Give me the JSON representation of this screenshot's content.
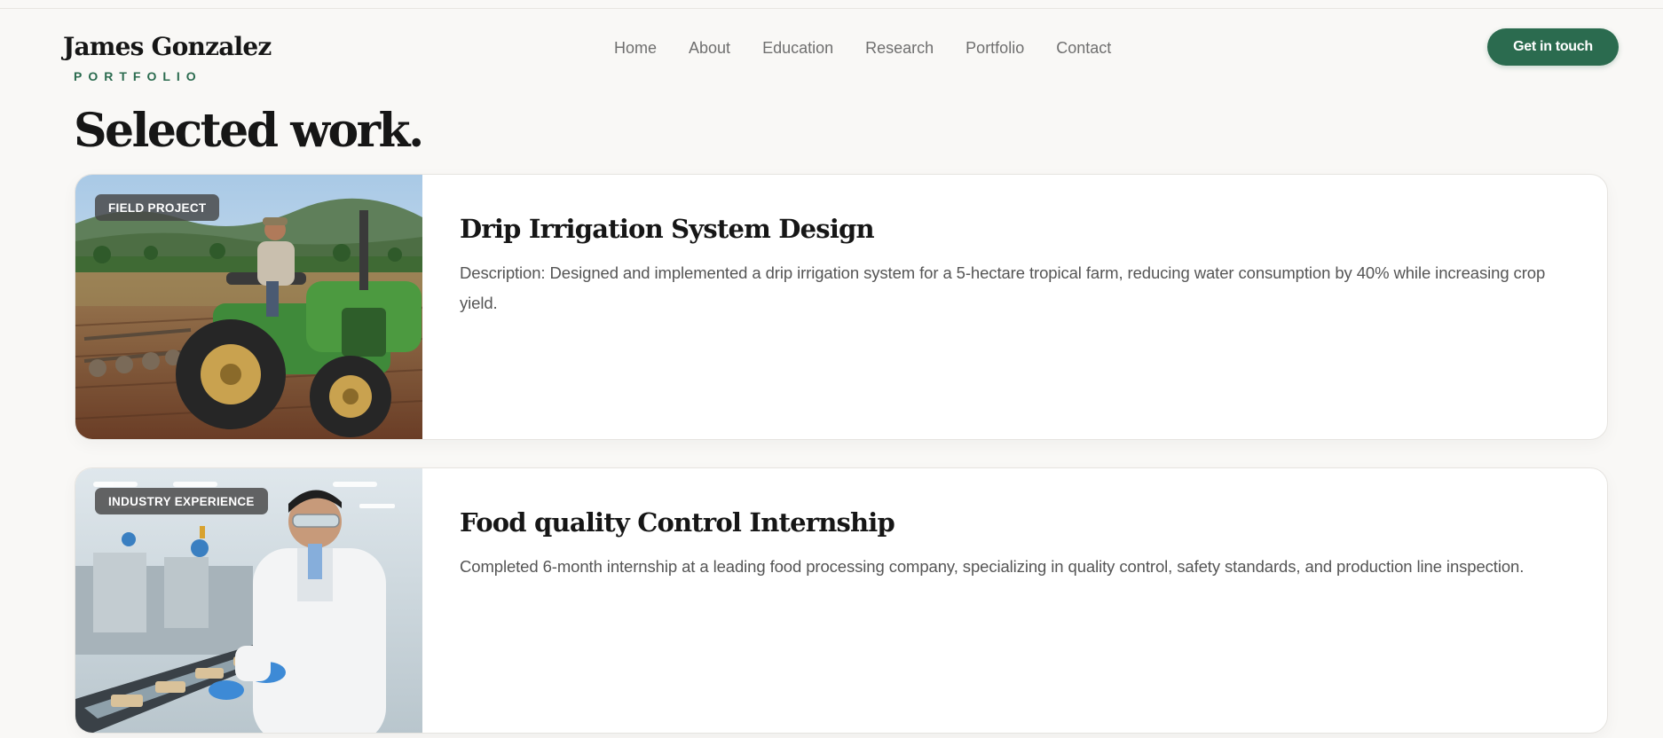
{
  "header": {
    "brand_name": "James Gonzalez",
    "brand_sub": "PORTFOLIO",
    "nav": [
      "Home",
      "About",
      "Education",
      "Research",
      "Portfolio",
      "Contact"
    ],
    "cta_label": "Get in touch"
  },
  "section": {
    "title": "Selected work."
  },
  "cards": [
    {
      "badge": "FIELD PROJECT",
      "title": "Drip Irrigation System Design",
      "description": "Description: Designed and implemented a drip irrigation system for a 5-hectare tropical farm, reducing water consumption by 40% while increasing crop yield."
    },
    {
      "badge": "INDUSTRY EXPERIENCE",
      "title": "Food quality Control Internship",
      "description": "Completed 6-month internship at a leading food processing company, specializing in quality control, safety standards, and production line inspection."
    }
  ],
  "colors": {
    "accent": "#2b6b4f",
    "background": "#f9f8f6",
    "badge_bg": "#464646"
  }
}
